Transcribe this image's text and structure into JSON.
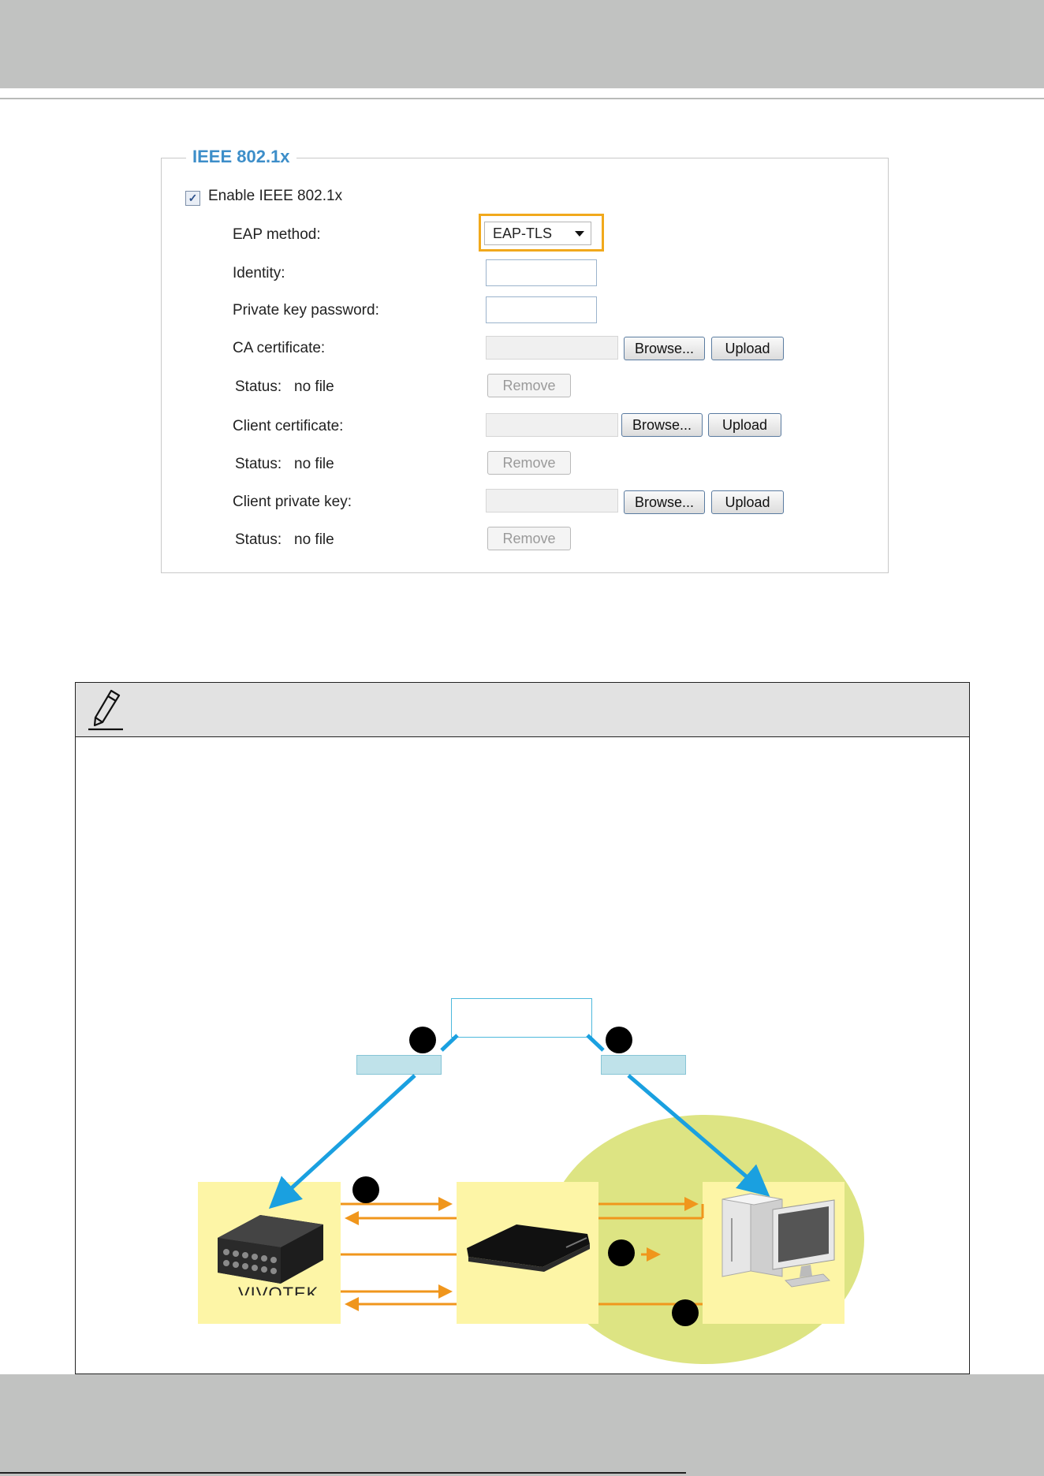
{
  "settings": {
    "section_title": "IEEE 802.1x",
    "enable_label": "Enable IEEE 802.1x",
    "enable_checked": true,
    "eap_method_label": "EAP method:",
    "eap_method_value": "EAP-TLS",
    "identity_label": "Identity:",
    "private_key_password_label": "Private key password:",
    "ca_certificate_label": "CA certificate:",
    "client_certificate_label": "Client certificate:",
    "client_private_key_label": "Client private key:",
    "status_label": "Status:",
    "status_value": "no file",
    "browse_label": "Browse...",
    "upload_label": "Upload",
    "remove_label": "Remove"
  },
  "diagram": {
    "device_label": "VIVOTEK",
    "colors": {
      "arrow_blue": "#1aa0e0",
      "arrow_orange": "#f0961c",
      "box_yellow": "#fdf5a6",
      "ellipse_green": "#dde483"
    }
  },
  "icons": {
    "note": "pencil-icon"
  }
}
